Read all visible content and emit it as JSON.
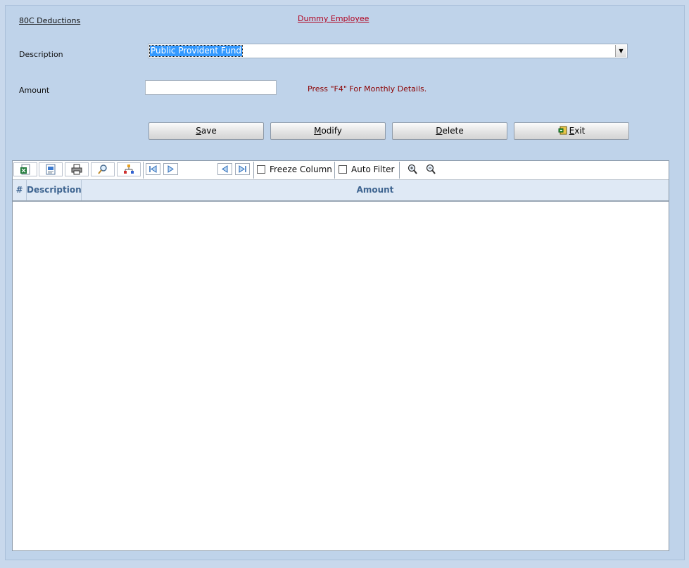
{
  "form": {
    "title": "80C Deductions",
    "employee": "Dummy Employee",
    "description_label": "Description",
    "description_value": "Public Provident Fund",
    "amount_label": "Amount",
    "amount_value": "",
    "hint": "Press \"F4\" For Monthly Details."
  },
  "buttons": {
    "save_pre": "",
    "save_key": "S",
    "save_post": "ave",
    "modify_pre": "",
    "modify_key": "M",
    "modify_post": "odify",
    "delete_pre": "",
    "delete_key": "D",
    "delete_post": "elete",
    "exit_pre": "",
    "exit_key": "E",
    "exit_post": "xit"
  },
  "grid": {
    "toolbar": {
      "icons": [
        "excel-export-icon",
        "html-export-icon",
        "print-icon",
        "find-icon",
        "hierarchy-icon",
        "first-record-icon",
        "next-record-icon",
        "previous-record-icon",
        "last-record-icon",
        "zoom-in-icon",
        "zoom-out-icon"
      ],
      "freeze_column_label": "Freeze Column",
      "auto_filter_label": "Auto Filter",
      "freeze_column_checked": false,
      "auto_filter_checked": false
    },
    "columns": [
      "#",
      "Description",
      "Amount"
    ],
    "rows": []
  },
  "colors": {
    "background": "#bfd3ea",
    "employee_link": "#b1001e",
    "hint": "#8b0000",
    "header_text": "#3e6490",
    "selection": "#3399ff"
  }
}
